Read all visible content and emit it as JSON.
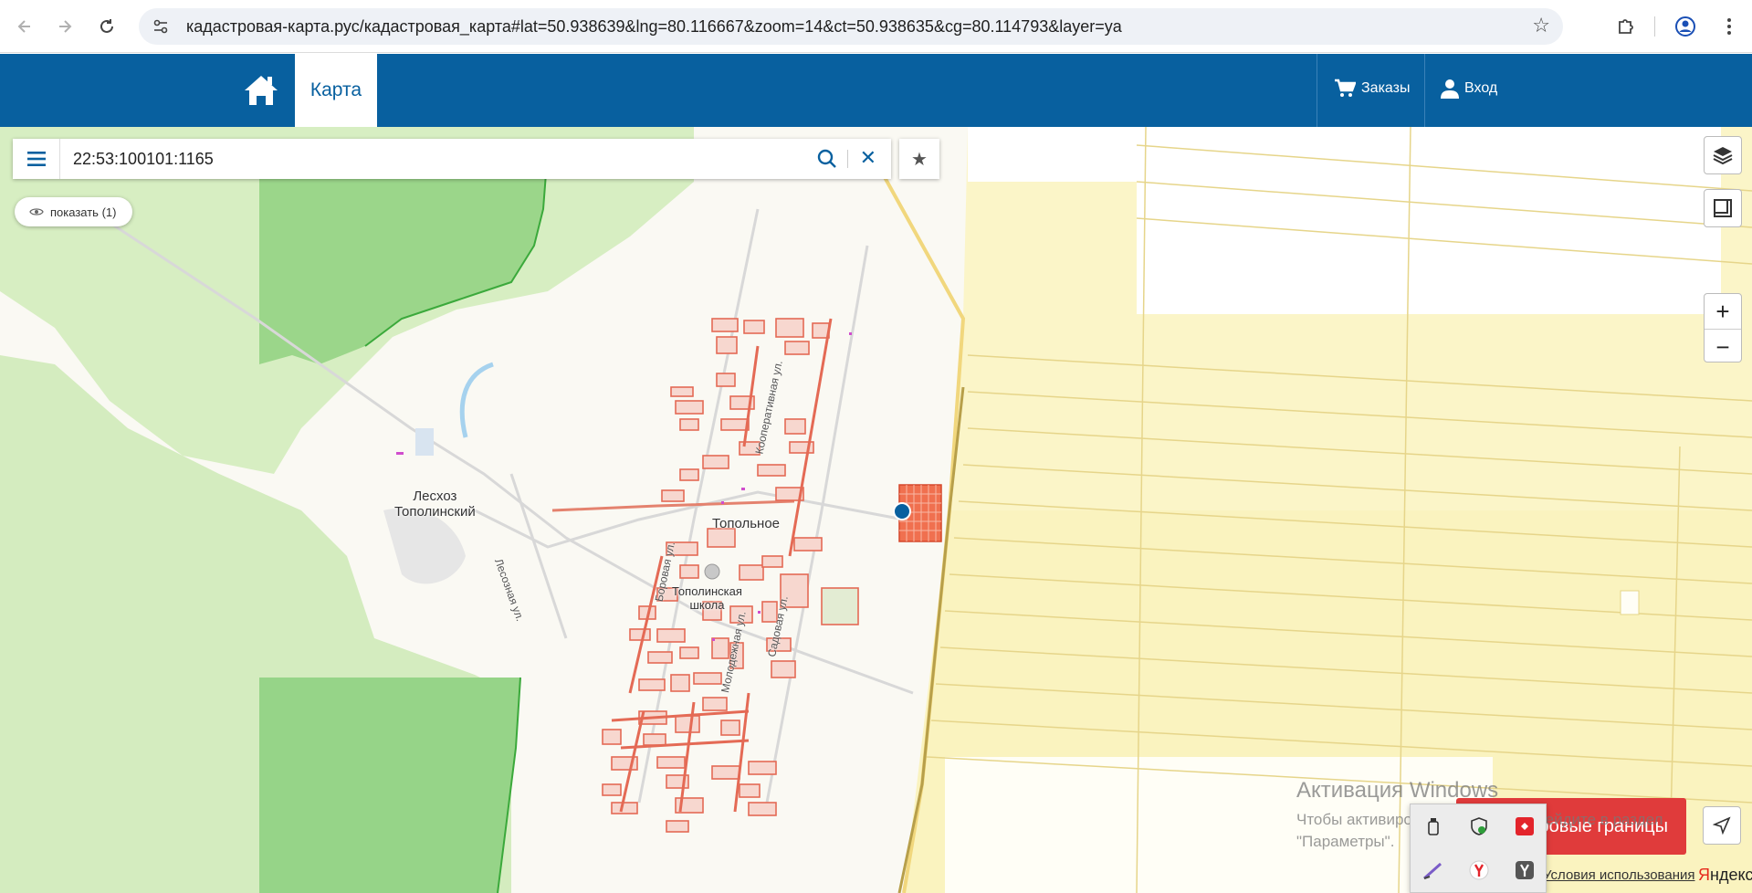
{
  "browser": {
    "url": "кадастровая-карта.рус/кадастровая_карта#lat=50.938639&lng=80.116667&zoom=14&ct=50.938635&cg=80.114793&layer=ya",
    "back_icon": "arrow-left-icon",
    "forward_icon": "arrow-right-icon",
    "reload_icon": "reload-icon",
    "bookmark_icon": "star-icon",
    "extensions_icon": "puzzle-icon",
    "profile_icon": "profile-icon"
  },
  "header": {
    "home_icon": "home-icon",
    "tab_map": "Карта",
    "orders": "Заказы",
    "login": "Вход",
    "colors": {
      "brand": "#08609f",
      "accent_red": "#e03b3b"
    }
  },
  "search": {
    "value": "22:53:100101:1165",
    "show_button": "показать (1)"
  },
  "map": {
    "labels": {
      "leskhoz": "Лесхоз",
      "leskhoz2": "Тополинский",
      "village": "Топольное",
      "school1": "Тополинская",
      "school2": "школа"
    },
    "streets": {
      "kooperativnaya": "Кооперативная ул.",
      "borovaya": "Боровая ул.",
      "lesoznaya": "Лесозная ул.",
      "molodezhnaya": "Молодежная ул.",
      "sadovaya": "Садовая ул."
    }
  },
  "controls": {
    "zoom_in": "+",
    "zoom_out": "−"
  },
  "bottom": {
    "boundary_button": "ровые границы",
    "activation_title": "Активация Windows",
    "activation_line1": "Чтобы активировать Windows, перейдите в раздел",
    "activation_line2": "\"Параметры\".",
    "terms": "Условия использования",
    "yandex_first": "Я",
    "yandex_rest": "ндекс"
  }
}
